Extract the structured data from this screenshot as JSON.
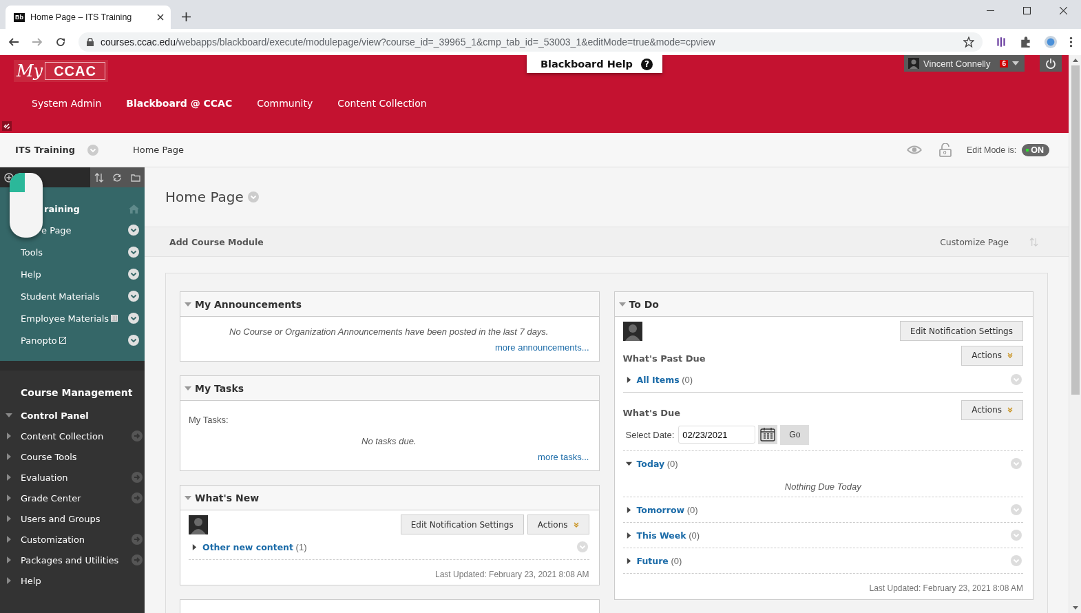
{
  "browser": {
    "favicon": "Bb",
    "tab_title": "Home Page – ITS Training",
    "url_host": "courses.ccac.edu",
    "url_path": "/webapps/blackboard/execute/modulepage/view?course_id=_39965_1&cmp_tab_id=_53003_1&editMode=true&mode=cpview"
  },
  "header": {
    "logo": {
      "script": "My",
      "name": "CCAC"
    },
    "help_label": "Blackboard Help",
    "help_icon": "?",
    "user_name": "Vincent Connelly",
    "notification_count": "6",
    "tabs": [
      {
        "label": "System Admin",
        "selected": false
      },
      {
        "label": "Blackboard @ CCAC",
        "selected": true
      },
      {
        "label": "Community",
        "selected": false
      },
      {
        "label": "Content Collection",
        "selected": false
      }
    ]
  },
  "breadcrumb": {
    "course": "ITS Training",
    "page": "Home Page",
    "edit_mode_label": "Edit Mode is:",
    "edit_mode": {
      "on": true,
      "label": "ON"
    },
    "locked_count": "0"
  },
  "course_menu": [
    {
      "label": "raining",
      "kind": "heading"
    },
    {
      "label": "e Page",
      "kind": "page"
    },
    {
      "label": "Tools",
      "kind": "page"
    },
    {
      "label": "Help",
      "kind": "page"
    },
    {
      "label": "Student Materials",
      "kind": "page"
    },
    {
      "label": "Employee Materials",
      "kind": "grid"
    },
    {
      "label": "Panopto",
      "kind": "hidden"
    }
  ],
  "course_management": {
    "title": "Course Management",
    "control_panel": {
      "label": "Control Panel",
      "expanded": true,
      "items": [
        {
          "label": "Content Collection",
          "goto": true
        },
        {
          "label": "Course Tools",
          "goto": false
        },
        {
          "label": "Evaluation",
          "goto": true
        },
        {
          "label": "Grade Center",
          "goto": true
        },
        {
          "label": "Users and Groups",
          "goto": false
        },
        {
          "label": "Customization",
          "goto": true
        },
        {
          "label": "Packages and Utilities",
          "goto": true
        },
        {
          "label": "Help",
          "goto": false
        }
      ]
    }
  },
  "page": {
    "title": "Home Page",
    "add_module": "Add Course Module",
    "customize": "Customize Page"
  },
  "announcements": {
    "title": "My Announcements",
    "expanded": true,
    "message": "No Course or Organization Announcements have been posted in the last 7 days.",
    "link": "more announcements..."
  },
  "tasks": {
    "title": "My Tasks",
    "expanded": true,
    "label": "My Tasks:",
    "message": "No tasks due.",
    "link": "more tasks..."
  },
  "whats_new": {
    "title": "What's New",
    "expanded": true,
    "buttons": [
      "Edit Notification Settings",
      "Actions"
    ],
    "items": [
      {
        "label": "Other new content",
        "count": "(1)",
        "expanded": false
      }
    ],
    "updated": "Last Updated: February 23, 2021 8:08 AM"
  },
  "todo": {
    "title": "To Do",
    "expanded": true,
    "button": "Edit Notification Settings",
    "past_due": {
      "title": "What's Past Due",
      "actions": "Actions",
      "items": [
        {
          "label": "All Items",
          "count": "(0)",
          "expanded": false
        }
      ]
    },
    "due": {
      "title": "What's Due",
      "actions": "Actions",
      "date_label": "Select Date:",
      "date": "02/23/2021",
      "go": "Go",
      "groups": [
        {
          "label": "Today",
          "count": "(0)",
          "expanded": true,
          "empty": "Nothing Due Today"
        },
        {
          "label": "Tomorrow",
          "count": "(0)",
          "expanded": false
        },
        {
          "label": "This Week",
          "count": "(0)",
          "expanded": false
        },
        {
          "label": "Future",
          "count": "(0)",
          "expanded": false
        }
      ]
    },
    "updated": "Last Updated: February 23, 2021 8:08 AM"
  }
}
